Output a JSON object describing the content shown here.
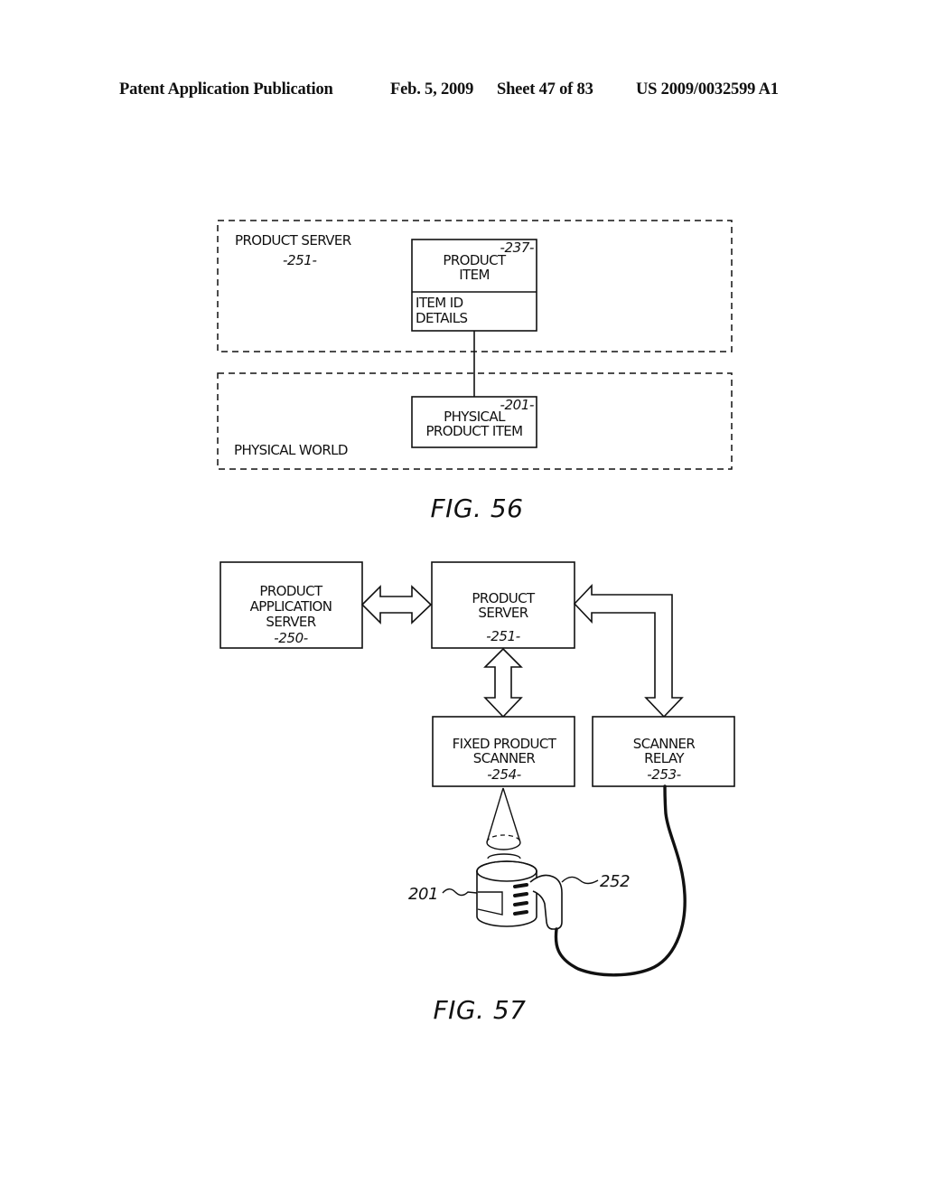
{
  "header": {
    "publication": "Patent Application Publication",
    "date": "Feb. 5, 2009",
    "sheet": "Sheet 47 of 83",
    "number": "US 2009/0032599 A1"
  },
  "fig56": {
    "caption": "FIG. 56",
    "product_server_region": {
      "label": "PRODUCT SERVER",
      "ref": "-251-"
    },
    "product_item": {
      "line1": "PRODUCT",
      "line2": "ITEM",
      "ref": "-237-",
      "details_line1": "ITEM ID",
      "details_line2": "DETAILS"
    },
    "physical_world_region": {
      "label": "PHYSICAL WORLD"
    },
    "physical_product_item": {
      "line1": "PHYSICAL",
      "line2": "PRODUCT ITEM",
      "ref": "-201-"
    }
  },
  "fig57": {
    "caption": "FIG. 57",
    "product_application_server": {
      "line1": "PRODUCT",
      "line2": "APPLICATION",
      "line3": "SERVER",
      "ref": "-250-"
    },
    "product_server": {
      "line1": "PRODUCT",
      "line2": "SERVER",
      "ref": "-251-"
    },
    "fixed_product_scanner": {
      "line1": "FIXED PRODUCT",
      "line2": "SCANNER",
      "ref": "-254-"
    },
    "scanner_relay": {
      "line1": "SCANNER",
      "line2": "RELAY",
      "ref": "-253-"
    },
    "product_ref": "201",
    "handheld_scanner_ref": "252"
  }
}
